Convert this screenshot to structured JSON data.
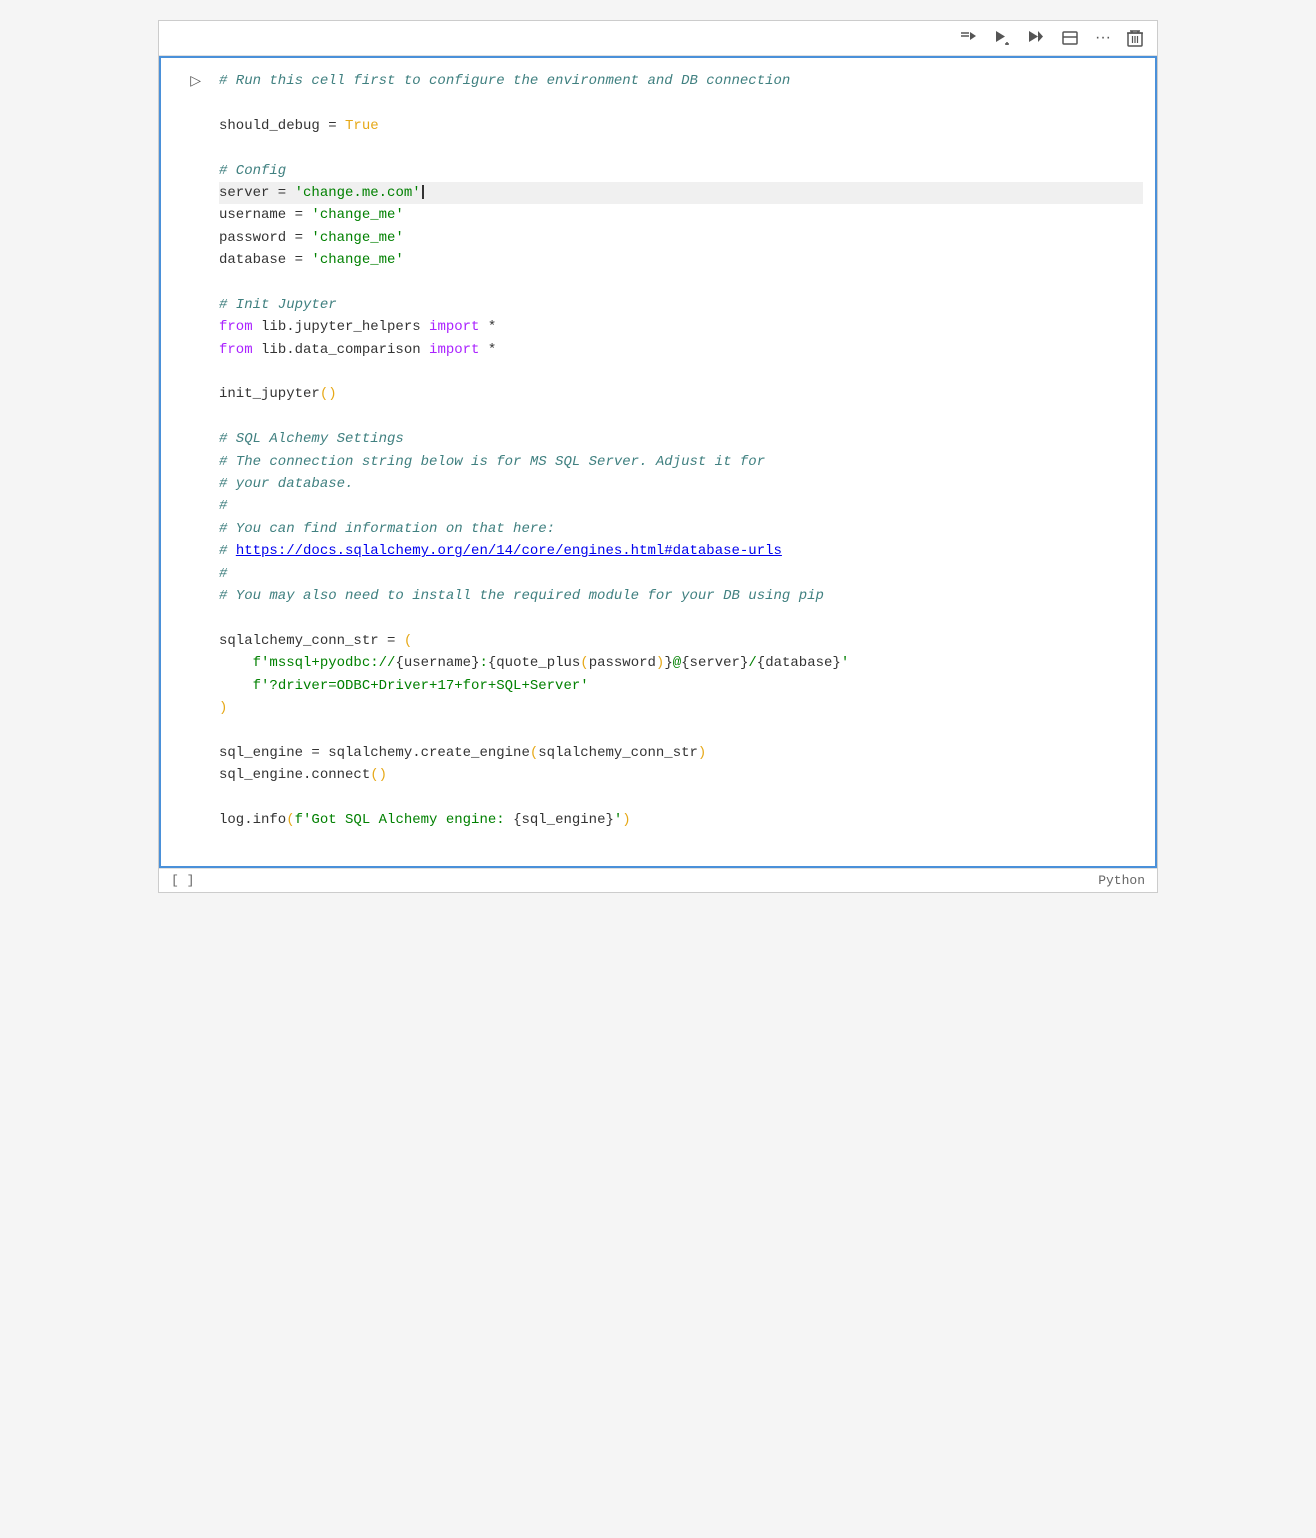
{
  "toolbar": {
    "buttons": [
      {
        "id": "run-all-above",
        "label": "⊳≡",
        "unicode": "⊳≡"
      },
      {
        "id": "run-cell-advance",
        "label": "▷↓",
        "unicode": "▷"
      },
      {
        "id": "run-next",
        "label": "▷↓",
        "unicode": "▷"
      },
      {
        "id": "toggle-output",
        "label": "⊟",
        "unicode": "⊟"
      },
      {
        "id": "more-options",
        "label": "···",
        "unicode": "···"
      },
      {
        "id": "delete-cell",
        "label": "🗑",
        "unicode": "🗑"
      }
    ]
  },
  "cell": {
    "run_indicator": "▷",
    "bottom_left": "[ ]",
    "bottom_right": "Python"
  },
  "code": {
    "comment1": "# Run this cell first to configure the environment and DB connection",
    "line_debug": "should_debug = True",
    "comment_config": "# Config",
    "line_server": "server = 'change.me.com'",
    "line_username": "username = 'change_me'",
    "line_password": "password = 'change_me'",
    "line_database": "database = 'change_me'",
    "comment_init": "# Init Jupyter",
    "line_import1": "from lib.jupyter_helpers import *",
    "line_import2": "from lib.data_comparison import *",
    "line_init": "init_jupyter()",
    "comment_sql1": "# SQL Alchemy Settings",
    "comment_sql2": "# The connection string below is for MS SQL Server. Adjust it for",
    "comment_sql3": "# your database.",
    "comment_sql4": "#",
    "comment_sql5": "# You can find information on that here:",
    "comment_sql6_text": "# ",
    "comment_sql6_url": "https://docs.sqlalchemy.org/en/14/core/engines.html#database-urls",
    "comment_sql7": "#",
    "comment_sql8": "# You may also need to install the required module for your DB using pip",
    "line_conn_assign": "sqlalchemy_conn_str = (",
    "line_conn1": "    f'mssql+pyodbc://{username}:{quote_plus(password)}@{server}/{database}'",
    "line_conn2": "    f'?driver=ODBC+Driver+17+for+SQL+Server'",
    "line_conn_close": ")",
    "line_engine": "sql_engine = sqlalchemy.create_engine(sqlalchemy_conn_str)",
    "line_connect": "sql_engine.connect()",
    "line_log": "log.info(f'Got SQL Alchemy engine: {sql_engine}')"
  }
}
